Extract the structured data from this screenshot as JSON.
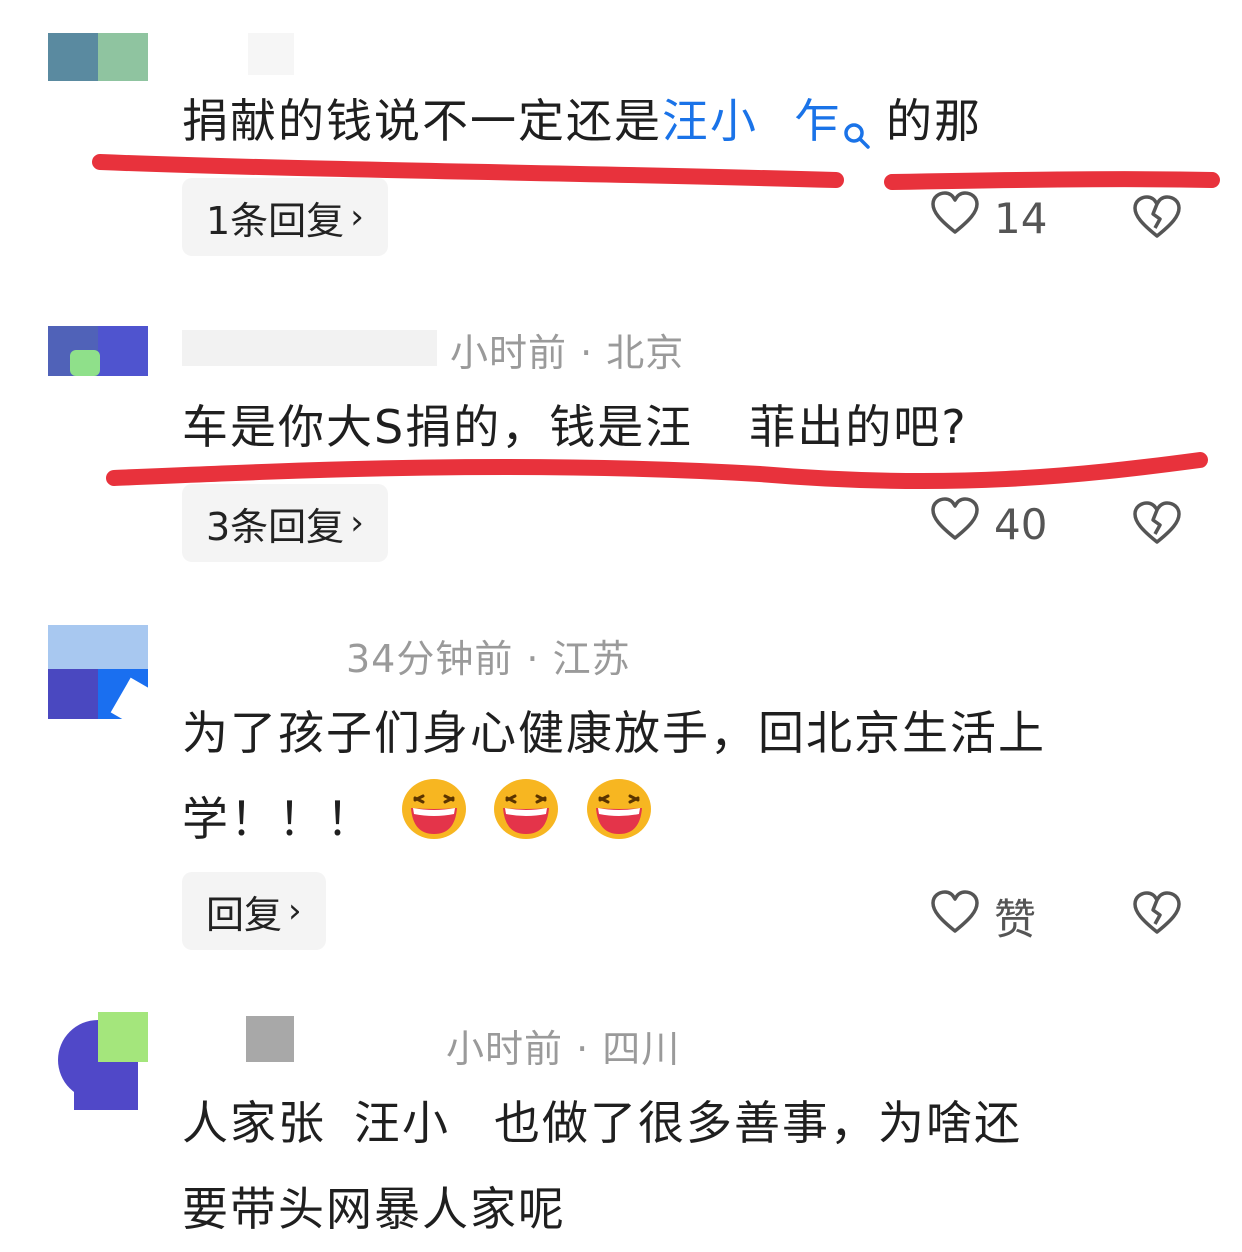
{
  "comments": [
    {
      "meta": "",
      "text_before": "捐献的钱说不一定还是",
      "mention": "汪小",
      "mention_tail": "乍",
      "text_after": "的那",
      "reply_label": "1条回复",
      "likes": "14"
    },
    {
      "meta": "小时前 · 北京",
      "text": "车是你大S捐的，钱是汪",
      "text_after": "菲出的吧?",
      "reply_label": "3条回复",
      "likes": "40"
    },
    {
      "meta": "34分钟前 · 江苏",
      "line1": "为了孩子们身心健康放手，回北京生活上",
      "line2": "学！！！",
      "reply_label": "回复",
      "likes": "赞"
    },
    {
      "meta": "小时前 · 四川",
      "line1_a": "人家张",
      "line1_b": "汪小",
      "line1_c": "也做了很多善事，为啥还",
      "line2": "要带头网暴人家呢"
    }
  ],
  "icons": {
    "heart": "heart-outline-icon",
    "broken_heart": "broken-heart-icon",
    "search": "search-icon",
    "emoji": "laughing-emoji"
  },
  "colors": {
    "underline": "#e8323c",
    "mention": "#1a73e8",
    "meta": "#9a9a9a"
  }
}
